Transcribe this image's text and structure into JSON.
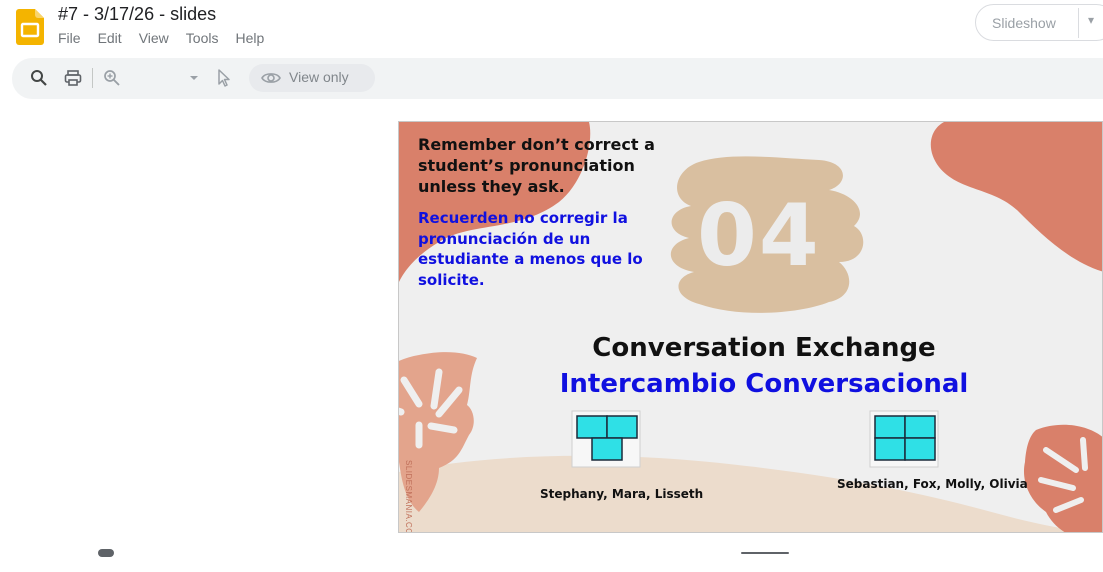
{
  "app": {
    "icon": "google-slides-icon",
    "accent_color": "#f4b400",
    "title": "#7 - 3/17/26 - slides",
    "menu": [
      "File",
      "Edit",
      "View",
      "Tools",
      "Help"
    ],
    "slideshow_label": "Slideshow"
  },
  "toolbar": {
    "icons": [
      "search-icon",
      "print-icon",
      "zoom-icon",
      "chevron-down-icon",
      "pointer-icon",
      "eye-icon"
    ],
    "view_only_label": "View only"
  },
  "slide": {
    "note_en": "Remember don’t correct a student’s pronunciation unless they ask.",
    "note_es": "Recuerden no corregir la pronunciación de un estudiante a menos que lo solicite.",
    "number": "04",
    "title_en": "Conversation Exchange",
    "title_es": "Intercambio Conversacional",
    "groups": [
      {
        "names": "Stephany, Mara, Lisseth"
      },
      {
        "names": "Sebastian, Fox, Molly, Olivia"
      }
    ],
    "watermark": "SLIDESMANIA.COM",
    "colors": {
      "text_blue": "#1010e0",
      "coral": "#d9806a",
      "tan": "#d9bfa0",
      "leaf": "#e3a48c",
      "sand": "#ecdccc",
      "table_cyan": "#2fe0e6"
    }
  }
}
